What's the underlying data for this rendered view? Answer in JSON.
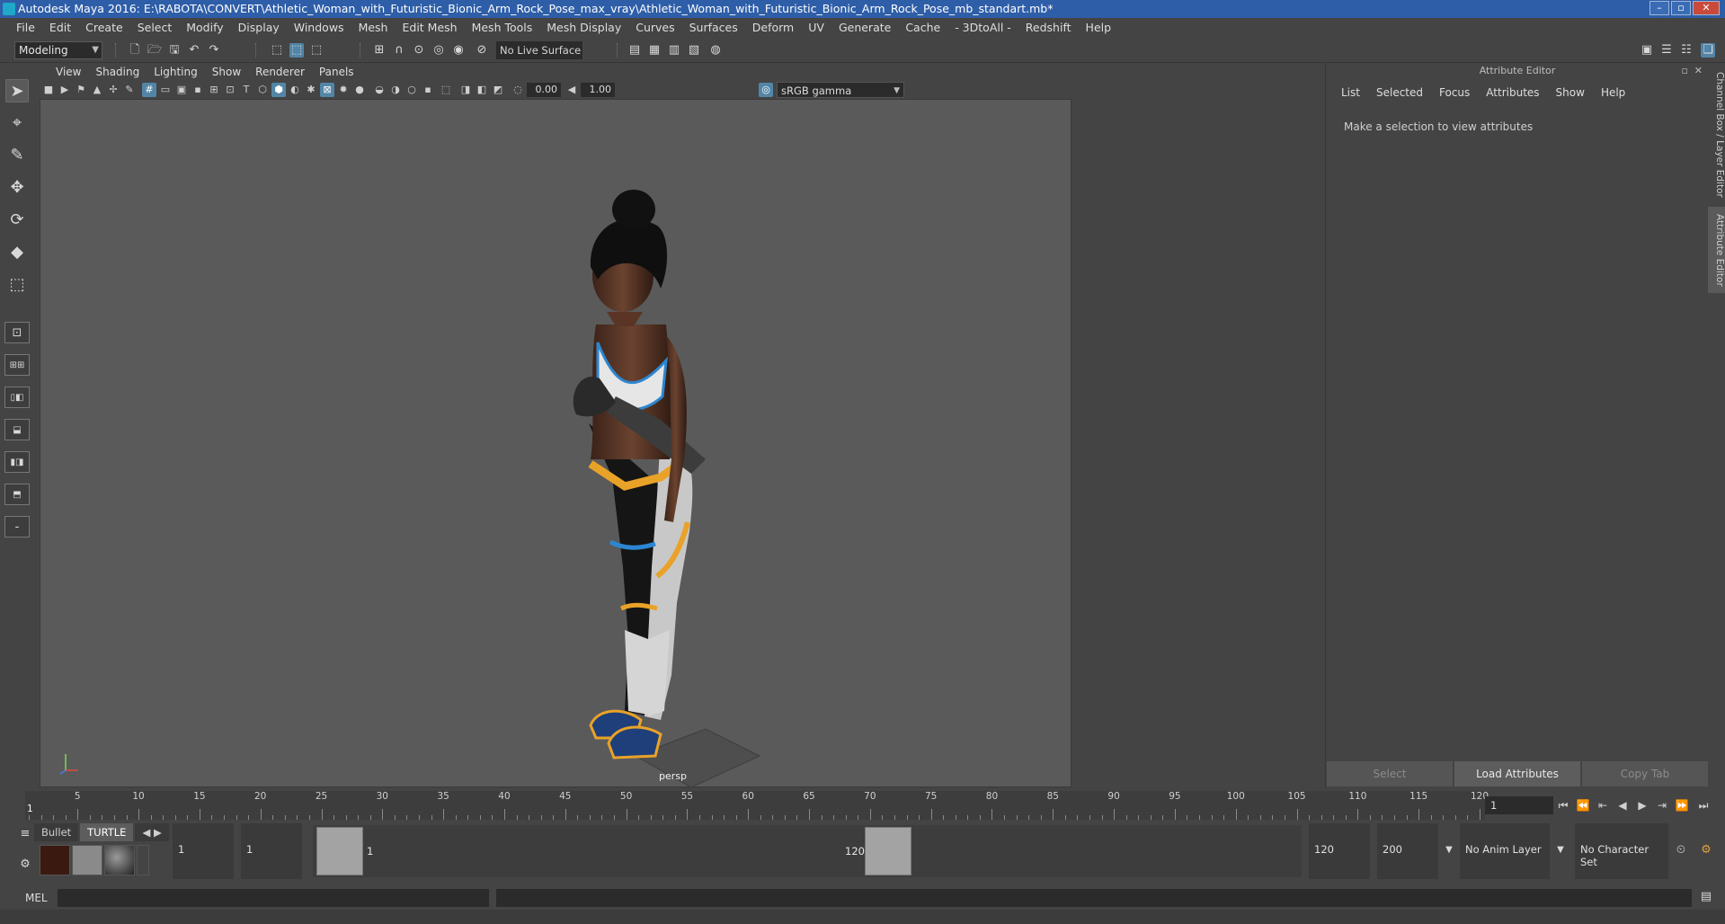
{
  "window": {
    "title": "Autodesk Maya 2016: E:\\RABOTA\\CONVERT\\Athletic_Woman_with_Futuristic_Bionic_Arm_Rock_Pose_max_vray\\Athletic_Woman_with_Futuristic_Bionic_Arm_Rock_Pose_mb_standart.mb*",
    "minimize": "–",
    "maximize": "▫",
    "close": "✕"
  },
  "menubar": [
    "File",
    "Edit",
    "Create",
    "Select",
    "Modify",
    "Display",
    "Windows",
    "Mesh",
    "Edit Mesh",
    "Mesh Tools",
    "Mesh Display",
    "Curves",
    "Surfaces",
    "Deform",
    "UV",
    "Generate",
    "Cache",
    "- 3DtoAll -",
    "Redshift",
    "Help"
  ],
  "statusline": {
    "mode": "Modeling",
    "live_surface": "No Live Surface"
  },
  "viewport": {
    "panel_menu": [
      "View",
      "Shading",
      "Lighting",
      "Show",
      "Renderer",
      "Panels"
    ],
    "exposure": "0.00",
    "gamma": "1.00",
    "color_space": "sRGB gamma",
    "camera": "persp"
  },
  "attribute_editor": {
    "title": "Attribute Editor",
    "menu": [
      "List",
      "Selected",
      "Focus",
      "Attributes",
      "Show",
      "Help"
    ],
    "message": "Make a selection to view attributes",
    "buttons": {
      "select": "Select",
      "load": "Load Attributes",
      "copy": "Copy Tab"
    }
  },
  "side_tabs": {
    "channel_box": "Channel Box / Layer Editor",
    "attribute_editor": "Attribute Editor"
  },
  "timeline": {
    "ticks": [
      5,
      10,
      15,
      20,
      25,
      30,
      35,
      40,
      45,
      50,
      55,
      60,
      65,
      70,
      75,
      80,
      85,
      90,
      95,
      100,
      105,
      110,
      115,
      120
    ],
    "start": 1,
    "current_frame": "1",
    "end": 120,
    "current_field": "1"
  },
  "shelf": {
    "tabs": [
      "Bullet",
      "TURTLE"
    ]
  },
  "range": {
    "start": "1",
    "playback_start": "1",
    "handle_start": "1",
    "handle_end": "120",
    "playback_end": "120",
    "end": "200",
    "anim_layer": "No Anim Layer",
    "character_set": "No Character Set"
  },
  "cmdline": {
    "label": "MEL"
  },
  "colors": {
    "titlebar": "#2e5ea8",
    "accent": "#5285a6",
    "viewport": "#5a5a5a",
    "maya_logo": "#1fb7c7"
  }
}
